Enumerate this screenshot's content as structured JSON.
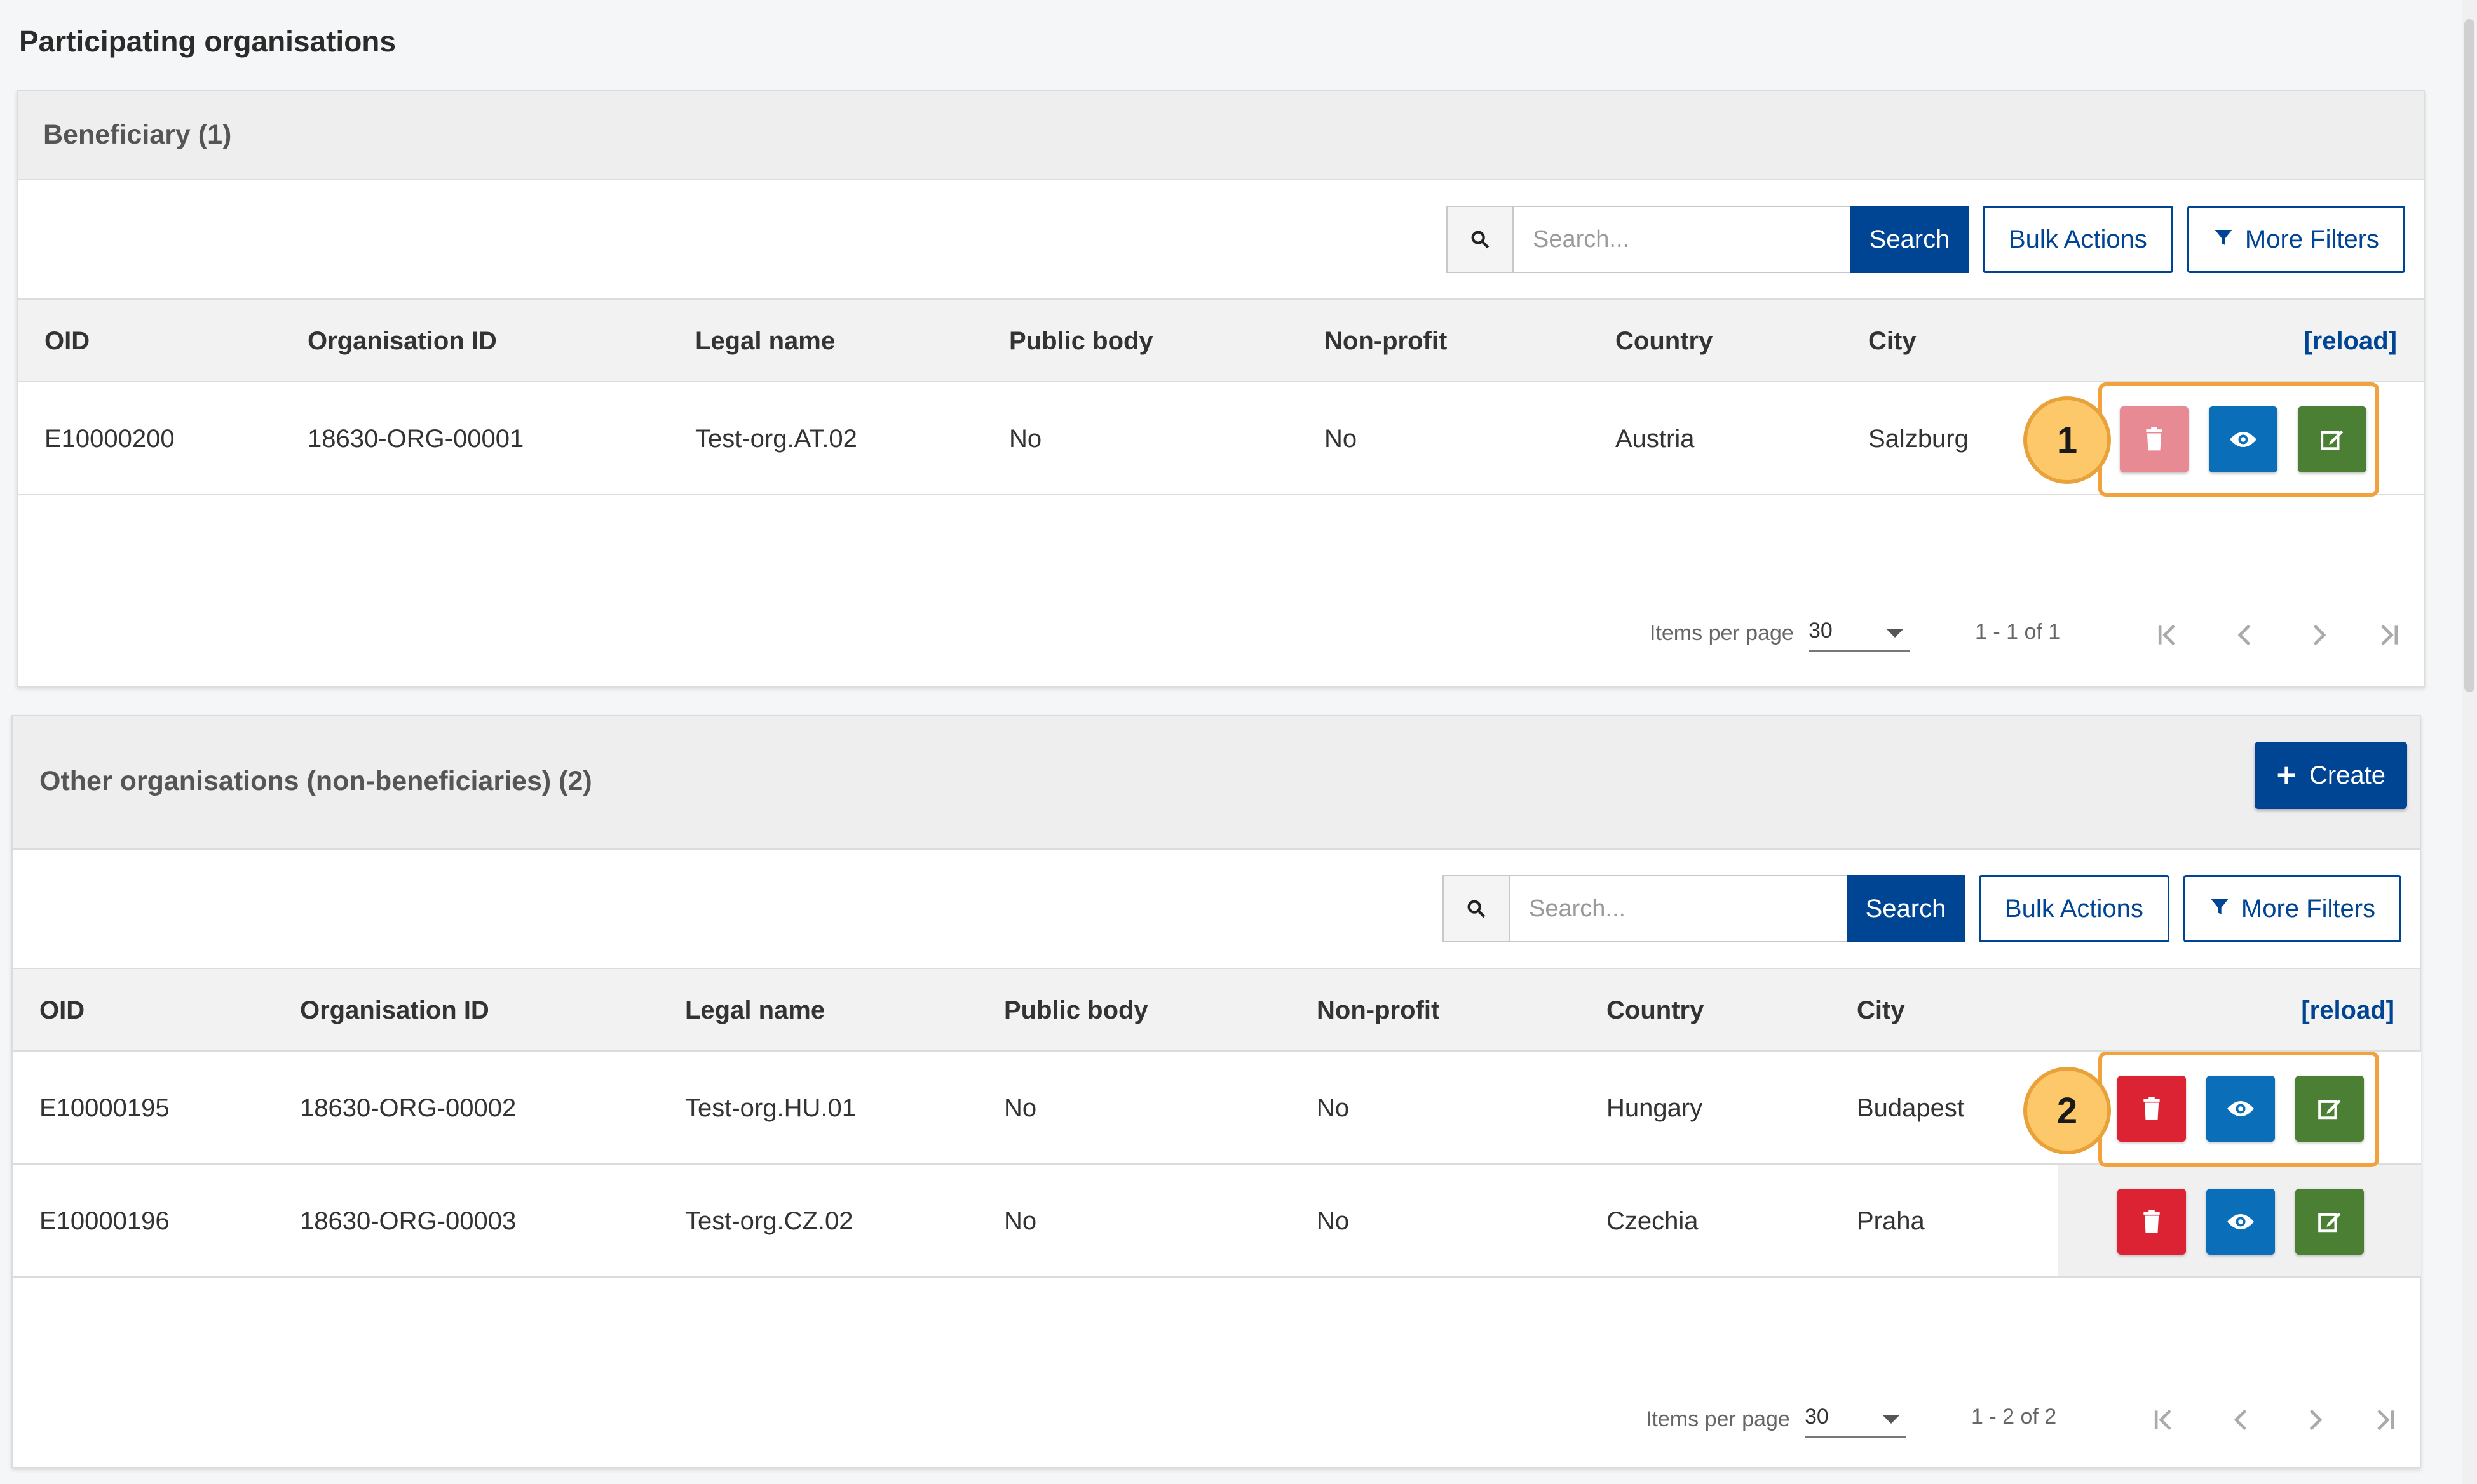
{
  "page": {
    "title": "Participating organisations"
  },
  "columns": {
    "oid": "OID",
    "org_id": "Organisation ID",
    "legal_name": "Legal name",
    "public_body": "Public body",
    "non_profit": "Non-profit",
    "country": "Country",
    "city": "City",
    "reload": "[reload]"
  },
  "toolbar": {
    "search_placeholder": "Search...",
    "search_label": "Search",
    "bulk_actions_label": "Bulk Actions",
    "more_filters_label": "More Filters"
  },
  "beneficiary": {
    "title": "Beneficiary (1)",
    "rows": [
      {
        "oid": "E10000200",
        "org_id": "18630-ORG-00001",
        "legal_name": "Test-org.AT.02",
        "public_body": "No",
        "non_profit": "No",
        "country": "Austria",
        "city": "Salzburg",
        "delete_disabled": true
      }
    ],
    "footer": {
      "items_per_page_label": "Items per page",
      "items_per_page": "30",
      "range": "1 - 1 of 1"
    }
  },
  "other": {
    "title": "Other organisations (non-beneficiaries) (2)",
    "create_label": "Create",
    "rows": [
      {
        "oid": "E10000195",
        "org_id": "18630-ORG-00002",
        "legal_name": "Test-org.HU.01",
        "public_body": "No",
        "non_profit": "No",
        "country": "Hungary",
        "city": "Budapest"
      },
      {
        "oid": "E10000196",
        "org_id": "18630-ORG-00003",
        "legal_name": "Test-org.CZ.02",
        "public_body": "No",
        "non_profit": "No",
        "country": "Czechia",
        "city": "Praha"
      }
    ],
    "footer": {
      "items_per_page_label": "Items per page",
      "items_per_page": "30",
      "range": "1 - 2 of 2"
    }
  },
  "callouts": {
    "one": "1",
    "two": "2"
  },
  "colors": {
    "primary": "#004494",
    "delete": "#dc2334",
    "delete_disabled": "#e88a94",
    "view": "#0a6eb8",
    "edit": "#4a7f34",
    "highlight": "#f2a23c"
  }
}
